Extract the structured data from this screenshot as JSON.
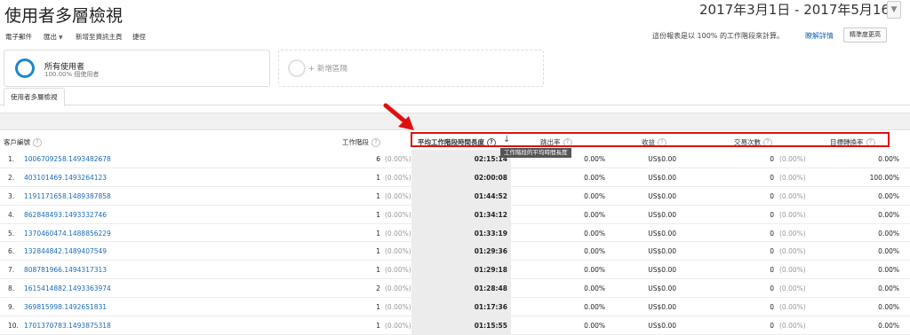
{
  "header": {
    "title": "使用者多層檢視",
    "date_range": "2017年3月1日 - 2017年5月16日",
    "date_caret": "▼"
  },
  "toolbar": {
    "email": "電子郵件",
    "export": "匯出",
    "add_dashboard": "新增至資訊主頁",
    "shortcut": "捷徑",
    "sampling_text": "這份報表是以 100% 的工作階段來計算。",
    "details_link": "瞭解詳情",
    "precision": "精準度更高"
  },
  "segments": {
    "active_name": "所有使用者",
    "active_sub": "100.00% 個使用者",
    "add_label": "+ 新增區隔"
  },
  "tabs": {
    "active": "使用者多層檢視"
  },
  "table": {
    "headers": {
      "client_id": "客戶編號",
      "sessions": "工作階段",
      "avg_duration": "平均工作階段時間長度",
      "bounce_rate": "跳出率",
      "revenue": "收益",
      "transactions": "交易次數",
      "conversion": "目標轉換率"
    },
    "help_glyph": "?",
    "sort_glyph": "↓",
    "tooltip": "工作階段的平均時間長度",
    "rows": [
      {
        "idx": "1.",
        "id": "1006709258.1493482678",
        "sessions": "6",
        "sessions_pct": "(0.00%)",
        "duration": "02:15:14",
        "bounce": "0.00%",
        "revenue": "US$0.00",
        "transactions": "0",
        "transactions_pct": "(0.00%)",
        "conversion": "0.00%"
      },
      {
        "idx": "2.",
        "id": "403101469.1493264123",
        "sessions": "1",
        "sessions_pct": "(0.00%)",
        "duration": "02:00:08",
        "bounce": "0.00%",
        "revenue": "US$0.00",
        "transactions": "0",
        "transactions_pct": "(0.00%)",
        "conversion": "100.00%"
      },
      {
        "idx": "3.",
        "id": "1191171658.1489387858",
        "sessions": "1",
        "sessions_pct": "(0.00%)",
        "duration": "01:44:52",
        "bounce": "0.00%",
        "revenue": "US$0.00",
        "transactions": "0",
        "transactions_pct": "(0.00%)",
        "conversion": "0.00%"
      },
      {
        "idx": "4.",
        "id": "862848493.1493332746",
        "sessions": "1",
        "sessions_pct": "(0.00%)",
        "duration": "01:34:12",
        "bounce": "0.00%",
        "revenue": "US$0.00",
        "transactions": "0",
        "transactions_pct": "(0.00%)",
        "conversion": "0.00%"
      },
      {
        "idx": "5.",
        "id": "1370460474.1488856229",
        "sessions": "1",
        "sessions_pct": "(0.00%)",
        "duration": "01:33:19",
        "bounce": "0.00%",
        "revenue": "US$0.00",
        "transactions": "0",
        "transactions_pct": "(0.00%)",
        "conversion": "0.00%"
      },
      {
        "idx": "6.",
        "id": "132844842.1489407549",
        "sessions": "1",
        "sessions_pct": "(0.00%)",
        "duration": "01:29:36",
        "bounce": "0.00%",
        "revenue": "US$0.00",
        "transactions": "0",
        "transactions_pct": "(0.00%)",
        "conversion": "0.00%"
      },
      {
        "idx": "7.",
        "id": "808781966.1494317313",
        "sessions": "1",
        "sessions_pct": "(0.00%)",
        "duration": "01:29:18",
        "bounce": "0.00%",
        "revenue": "US$0.00",
        "transactions": "0",
        "transactions_pct": "(0.00%)",
        "conversion": "0.00%"
      },
      {
        "idx": "8.",
        "id": "1615414882.1493363974",
        "sessions": "2",
        "sessions_pct": "(0.00%)",
        "duration": "01:28:48",
        "bounce": "0.00%",
        "revenue": "US$0.00",
        "transactions": "0",
        "transactions_pct": "(0.00%)",
        "conversion": "0.00%"
      },
      {
        "idx": "9.",
        "id": "369815998.1492651831",
        "sessions": "1",
        "sessions_pct": "(0.00%)",
        "duration": "01:17:36",
        "bounce": "0.00%",
        "revenue": "US$0.00",
        "transactions": "0",
        "transactions_pct": "(0.00%)",
        "conversion": "0.00%"
      },
      {
        "idx": "10.",
        "id": "1701370783.1493875318",
        "sessions": "1",
        "sessions_pct": "(0.00%)",
        "duration": "01:15:55",
        "bounce": "0.00%",
        "revenue": "US$0.00",
        "transactions": "0",
        "transactions_pct": "(0.00%)",
        "conversion": "0.00%"
      }
    ]
  },
  "colors": {
    "link": "#1a6bb8",
    "segment_ring": "#1e88c7",
    "highlight": "#e01010",
    "shaded_column": "#ececec"
  },
  "icons": {
    "segment": "circle-ring-icon",
    "help": "question-circle-icon",
    "sort": "sort-down-arrow-icon",
    "annotation": "red-arrow-icon"
  }
}
